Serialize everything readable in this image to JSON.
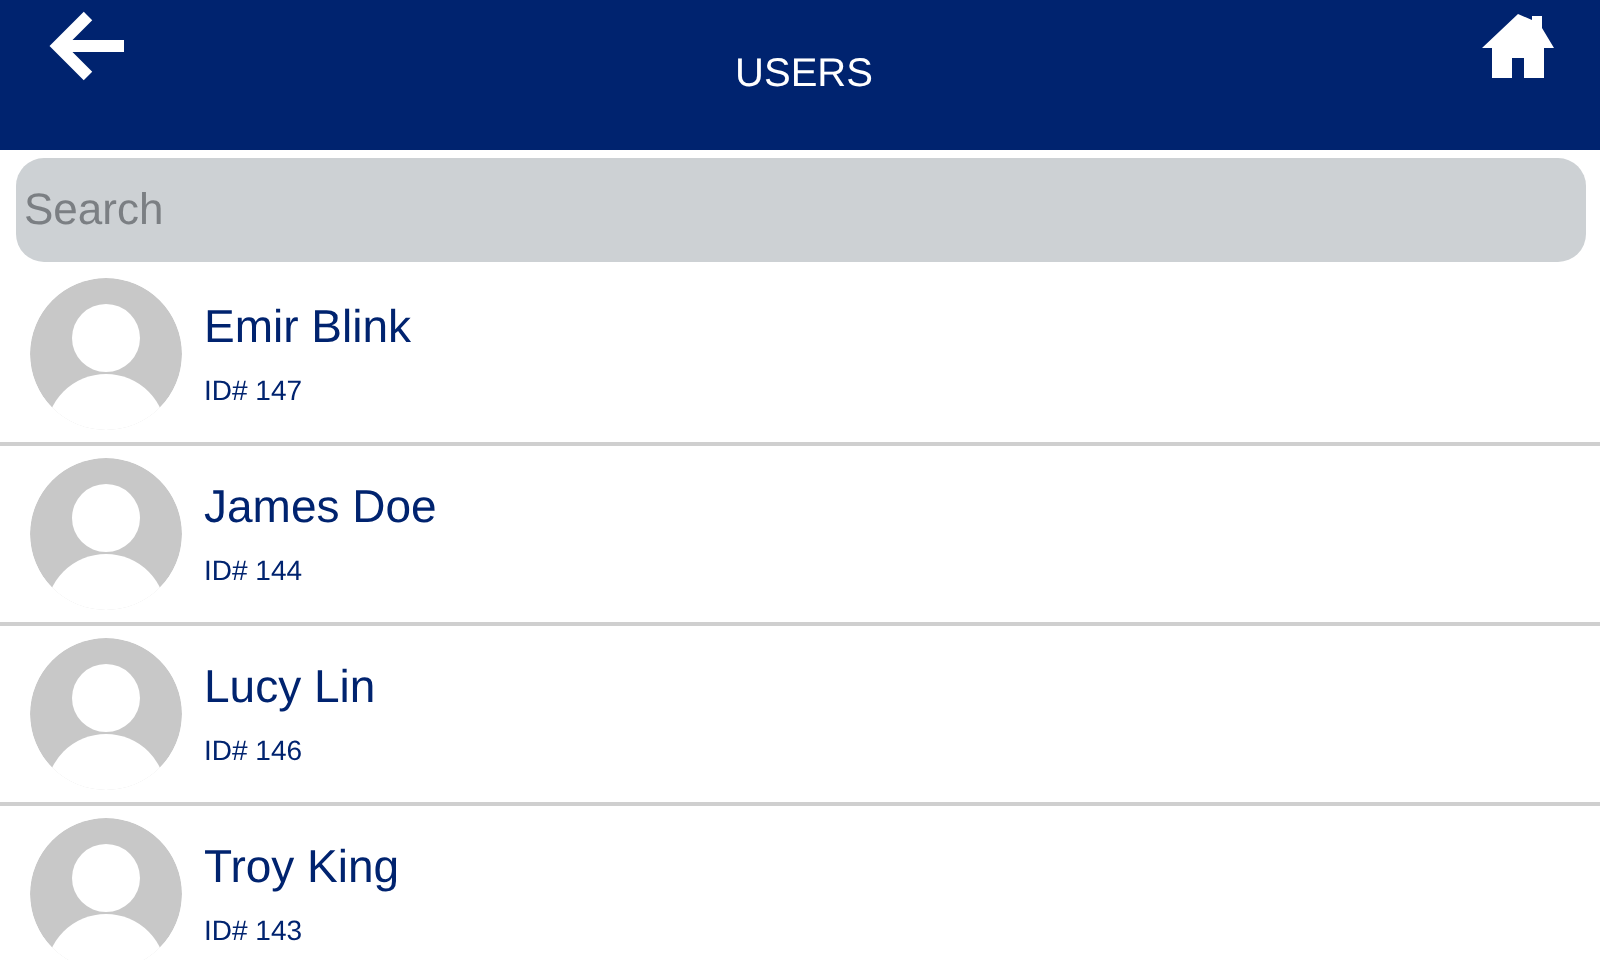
{
  "header": {
    "title": "USERS"
  },
  "search": {
    "placeholder": "Search"
  },
  "users": [
    {
      "name": "Emir Blink",
      "id": "ID# 147"
    },
    {
      "name": "James Doe",
      "id": "ID# 144"
    },
    {
      "name": "Lucy Lin",
      "id": "ID# 146"
    },
    {
      "name": "Troy King",
      "id": "ID# 143"
    }
  ]
}
